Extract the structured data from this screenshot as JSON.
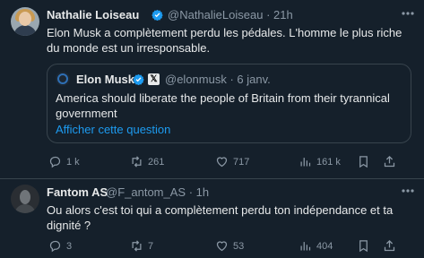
{
  "tweet": {
    "author_name": "Nathalie Loiseau",
    "handle": "@NathalieLoiseau",
    "time": "· 21h",
    "text": "Elon Musk a complètement perdu les pédales. L'homme le plus riche du monde est un irresponsable.",
    "quote": {
      "author_name": "Elon Musk",
      "handle": "@elonmusk",
      "time": "· 6 janv.",
      "text": "America should liberate the people of Britain from their tyrannical government",
      "show_more": "Afficher cette question"
    },
    "stats": {
      "replies": "1 k",
      "retweets": "261",
      "likes": "717",
      "views": "161 k"
    }
  },
  "reply": {
    "author_name": "Fantom AS",
    "handle": "@F_antom_AS",
    "time": "· 1h",
    "text": "Ou alors c'est toi qui a complètement perdu ton indépendance et ta dignité ?",
    "stats": {
      "replies": "3",
      "retweets": "7",
      "likes": "53",
      "views": "404"
    }
  },
  "colors": {
    "background": "#15202b",
    "text_primary": "#e7e9ea",
    "text_secondary": "#8b98a5",
    "link": "#1d9bf0",
    "verified": "#1d9bf0",
    "border": "#38444d"
  }
}
